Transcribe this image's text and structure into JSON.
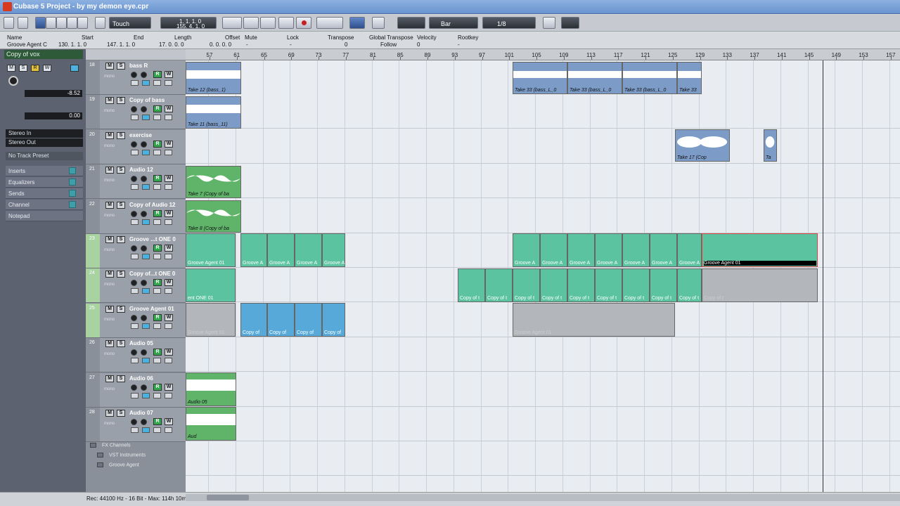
{
  "window": {
    "title": "Cubase 5 Project - by my demon eye.cpr"
  },
  "toolbar": {
    "automation_mode": "Touch",
    "position_primary": "1. 1. 1.   0",
    "position_secondary": "155. 4. 1.   0",
    "grid_type": "Bar",
    "quantize": "1/8"
  },
  "info_line": {
    "headers": [
      "Name",
      "Start",
      "End",
      "Length",
      "Offset",
      "Mute",
      "Lock",
      "Transpose",
      "Global Transpose",
      "Velocity",
      "Rootkey"
    ],
    "values": [
      "Groove Agent C",
      "130. 1. 1.   0",
      "147. 1. 1.   0",
      "17. 0. 0.   0",
      "0. 0. 0.   0",
      "-",
      "-",
      "0",
      "Follow",
      "0",
      "-"
    ]
  },
  "inspector": {
    "track_name": "Copy of vox",
    "volume": "-8.52",
    "pan": "0.00",
    "input_routing": "Stereo In",
    "output_routing": "Stereo Out",
    "track_preset": "No Track Preset",
    "sections": [
      "Inserts",
      "Equalizers",
      "Sends",
      "Channel",
      "Notepad"
    ]
  },
  "ruler": {
    "bars": [
      "57",
      "61",
      "65",
      "69",
      "73",
      "77",
      "81",
      "85",
      "89",
      "93",
      "97",
      "101",
      "105",
      "109",
      "113",
      "117",
      "121",
      "125",
      "129",
      "133",
      "137",
      "141",
      "145",
      "149",
      "153",
      "157"
    ]
  },
  "tracks": [
    {
      "number": "18",
      "name": "bass R",
      "type": "audio"
    },
    {
      "number": "19",
      "name": "Copy of bass",
      "type": "audio"
    },
    {
      "number": "20",
      "name": "exercise",
      "type": "audio"
    },
    {
      "number": "21",
      "name": "Audio 12",
      "type": "audio"
    },
    {
      "number": "22",
      "name": "Copy of Audio 12",
      "type": "audio"
    },
    {
      "number": "23",
      "name": "Groove ...t ONE 0",
      "type": "midi"
    },
    {
      "number": "24",
      "name": "Copy of...t ONE 0",
      "type": "midi"
    },
    {
      "number": "25",
      "name": "Groove Agent 01",
      "type": "midi"
    },
    {
      "number": "26",
      "name": "Audio 05",
      "type": "audio"
    },
    {
      "number": "27",
      "name": "Audio 06",
      "type": "audio"
    },
    {
      "number": "28",
      "name": "Audio 07",
      "type": "audio"
    }
  ],
  "folders": [
    "FX Channels",
    "VST Instruments",
    "Groove Agent"
  ],
  "events": {
    "e_bassR_1": "Take 12 (bass_1)",
    "e_bassR_2a": "Take 33 (bass_L_0",
    "e_bassR_2b": "Take 33 (bass_L_0",
    "e_bassR_2c": "Take 33 (bass_L_0",
    "e_bassR_2d": "Take 33",
    "e_copybass": "Take 11 (bass_11)",
    "e_exercise_1": "Take 17 (Cop",
    "e_exercise_2": "Ta",
    "e_audio12": "Take 7 (Copy of ba",
    "e_copyaudio12": "Take 8 (Copy of ba",
    "e_g23_1": "Groove Agent 01",
    "e_g23_2": "Groove A",
    "e_g23_last": "Groove Agent 01",
    "e_g24_1": "ent ONE 01",
    "e_g24_2": "Copy of t",
    "e_g25_1": "Groove Agent 01",
    "e_g25_2": "Copy of",
    "e_audio06_a": "Audio 05",
    "e_audio06_b": "Aud"
  },
  "status": {
    "text": "Rec: 44100 Hz - 16 Bit - Max: 114h 10m"
  },
  "colors": {
    "audio_blue": "#7c9cc7",
    "audio_green": "#5fb46a",
    "midi_teal": "#5cc3a1",
    "midi_blue": "#56a9d8",
    "muted_grey": "#b3b7bc",
    "arrange_bg": "#e9edf1"
  },
  "icons": [
    "cubase-logo-icon",
    "activate-project-icon",
    "constrain-delay-icon",
    "arrow-tool-icon",
    "range-tool-icon",
    "split-tool-icon",
    "glue-tool-icon",
    "erase-tool-icon",
    "zoom-tool-icon",
    "mute-tool-icon",
    "time-warp-tool-icon",
    "play-tool-icon",
    "rewind-icon",
    "forward-icon",
    "cycle-icon",
    "stop-icon",
    "play-icon",
    "record-icon",
    "snap-icon",
    "grid-icon",
    "quantize-icon",
    "color-icon"
  ]
}
